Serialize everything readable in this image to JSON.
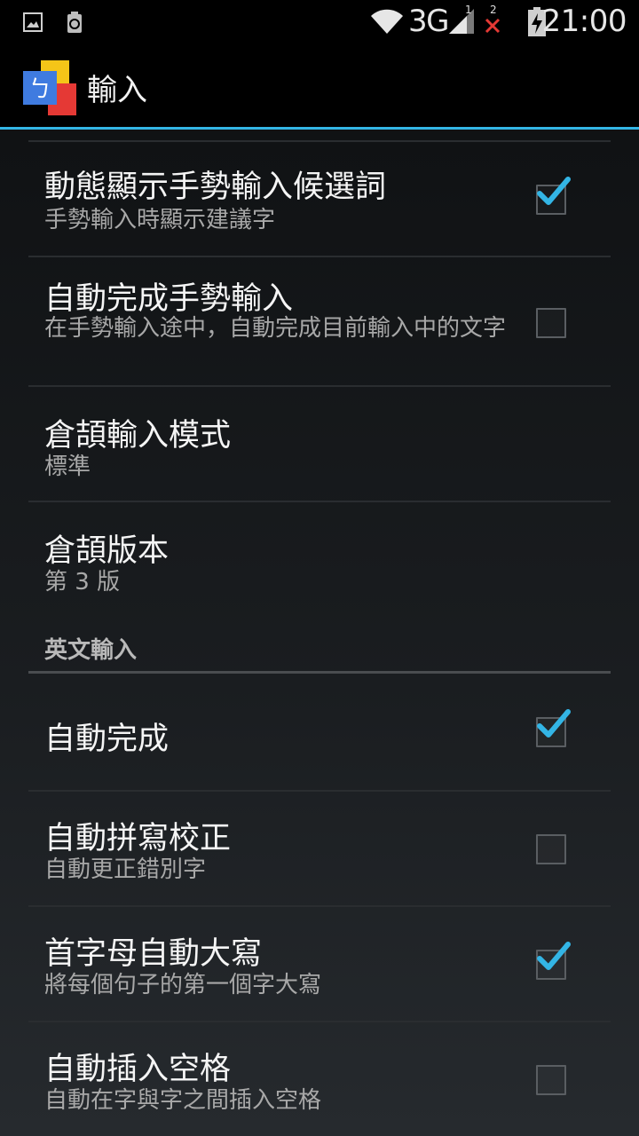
{
  "status_bar": {
    "left_icons": [
      "image-icon",
      "recycle-icon"
    ],
    "network": "3G",
    "signal_sim1": "1",
    "signal_sim2": "2",
    "time": "21:00"
  },
  "action_bar": {
    "app_icon": "zhuyin-input-icon",
    "app_icon_glyph": "ㄅ",
    "title": "輸入"
  },
  "settings": {
    "items": [
      {
        "title": "動態顯示手勢輸入候選詞",
        "subtitle": "手勢輸入時顯示建議字",
        "checked": true
      },
      {
        "title": "自動完成手勢輸入",
        "subtitle": "在手勢輸入途中，自動完成目前輸入中的文字",
        "checked": false
      },
      {
        "title": "倉頡輸入模式",
        "subtitle": "標準"
      },
      {
        "title": "倉頡版本",
        "subtitle": "第 3 版"
      }
    ],
    "category_english": "英文輸入",
    "english_items": [
      {
        "title": "自動完成",
        "subtitle": "",
        "checked": true
      },
      {
        "title": "自動拼寫校正",
        "subtitle": "自動更正錯別字",
        "checked": false
      },
      {
        "title": "首字母自動大寫",
        "subtitle": "將每個句子的第一個字大寫",
        "checked": true
      },
      {
        "title": "自動插入空格",
        "subtitle": "自動在字與字之間插入空格",
        "checked": false
      }
    ]
  },
  "colors": {
    "accent": "#33b5e5",
    "checkmark": "#33b5e5"
  }
}
